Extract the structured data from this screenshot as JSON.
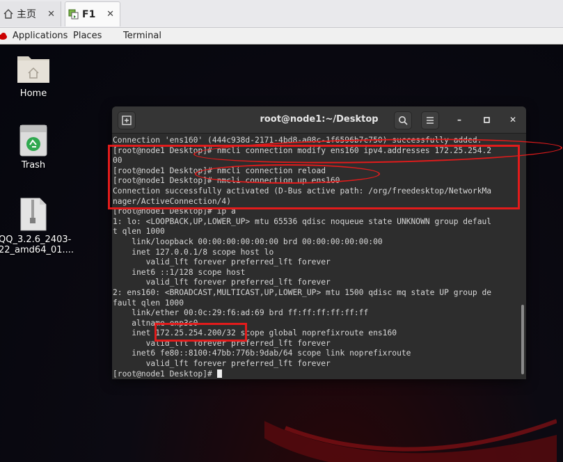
{
  "browser_tabs": [
    {
      "label": "主页",
      "icon": "home-icon"
    },
    {
      "label": "F1",
      "icon": "vm-icon",
      "active": true
    }
  ],
  "topbar": {
    "applications": "Applications",
    "places": "Places",
    "terminal": "Terminal"
  },
  "desktop_icons": [
    {
      "label": "Home",
      "icon": "folder-home-icon"
    },
    {
      "label": "Trash",
      "icon": "trash-icon"
    },
    {
      "label_line1": "QQ_3.2.6_2403-",
      "label_line2": "22_amd64_01....",
      "icon": "archive-file-icon"
    }
  ],
  "terminal": {
    "title": "root@node1:~/Desktop",
    "lines": [
      "Connection 'ens160' (444c938d-2171-4bd8-a08c-1f6596b7c750) successfully added.",
      "[root@node1 Desktop]# nmcli connection modify ens160 ipv4.addresses 172.25.254.2",
      "00",
      "[root@node1 Desktop]# nmcli connection reload",
      "[root@node1 Desktop]# nmcli connection up ens160",
      "Connection successfully activated (D-Bus active path: /org/freedesktop/NetworkMa",
      "nager/ActiveConnection/4)",
      "[root@node1 Desktop]# ip a",
      "1: lo: <LOOPBACK,UP,LOWER_UP> mtu 65536 qdisc noqueue state UNKNOWN group defaul",
      "t qlen 1000",
      "    link/loopback 00:00:00:00:00:00 brd 00:00:00:00:00:00",
      "    inet 127.0.0.1/8 scope host lo",
      "       valid_lft forever preferred_lft forever",
      "    inet6 ::1/128 scope host",
      "       valid_lft forever preferred_lft forever",
      "2: ens160: <BROADCAST,MULTICAST,UP,LOWER_UP> mtu 1500 qdisc mq state UP group de",
      "fault qlen 1000",
      "    link/ether 00:0c:29:f6:ad:69 brd ff:ff:ff:ff:ff:ff",
      "    altname enp3s0",
      "    inet 172.25.254.200/32 scope global noprefixroute ens160",
      "       valid_lft forever preferred_lft forever",
      "    inet6 fe80::8100:47bb:776b:9dab/64 scope link noprefixroute",
      "       valid_lft forever preferred_lft forever"
    ],
    "prompt": "[root@node1 Desktop]# "
  },
  "colors": {
    "annotation": "#e21b1b",
    "terminal_bg": "#2d2d2d",
    "terminal_fg": "#d8d8d8"
  }
}
